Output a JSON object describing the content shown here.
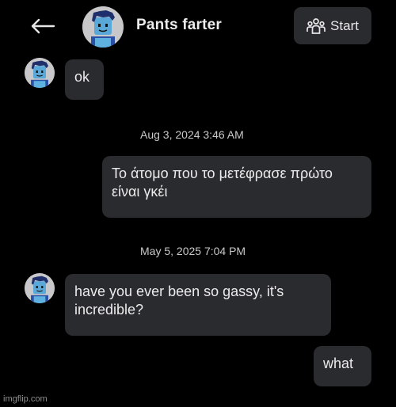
{
  "header": {
    "contact_name": "Pants farter",
    "start_label": "Start"
  },
  "messages": {
    "m1": "ok",
    "ts1": "Aug 3, 2024 3:46 AM",
    "m2": "Το άτομο που το μετέφρασε πρώτο είναι γκέι",
    "ts2": "May 5, 2025 7:04 PM",
    "m3": "have you ever been so gassy, it's incredible?",
    "m4": "what"
  },
  "watermark": "imgflip.com",
  "icons": {
    "back": "back-arrow-icon",
    "start": "group-icon"
  },
  "colors": {
    "background": "#000000",
    "bubble": "#2a2b2f",
    "avatar_body": "#5aa8d8",
    "avatar_hair": "#1f2f6b"
  }
}
